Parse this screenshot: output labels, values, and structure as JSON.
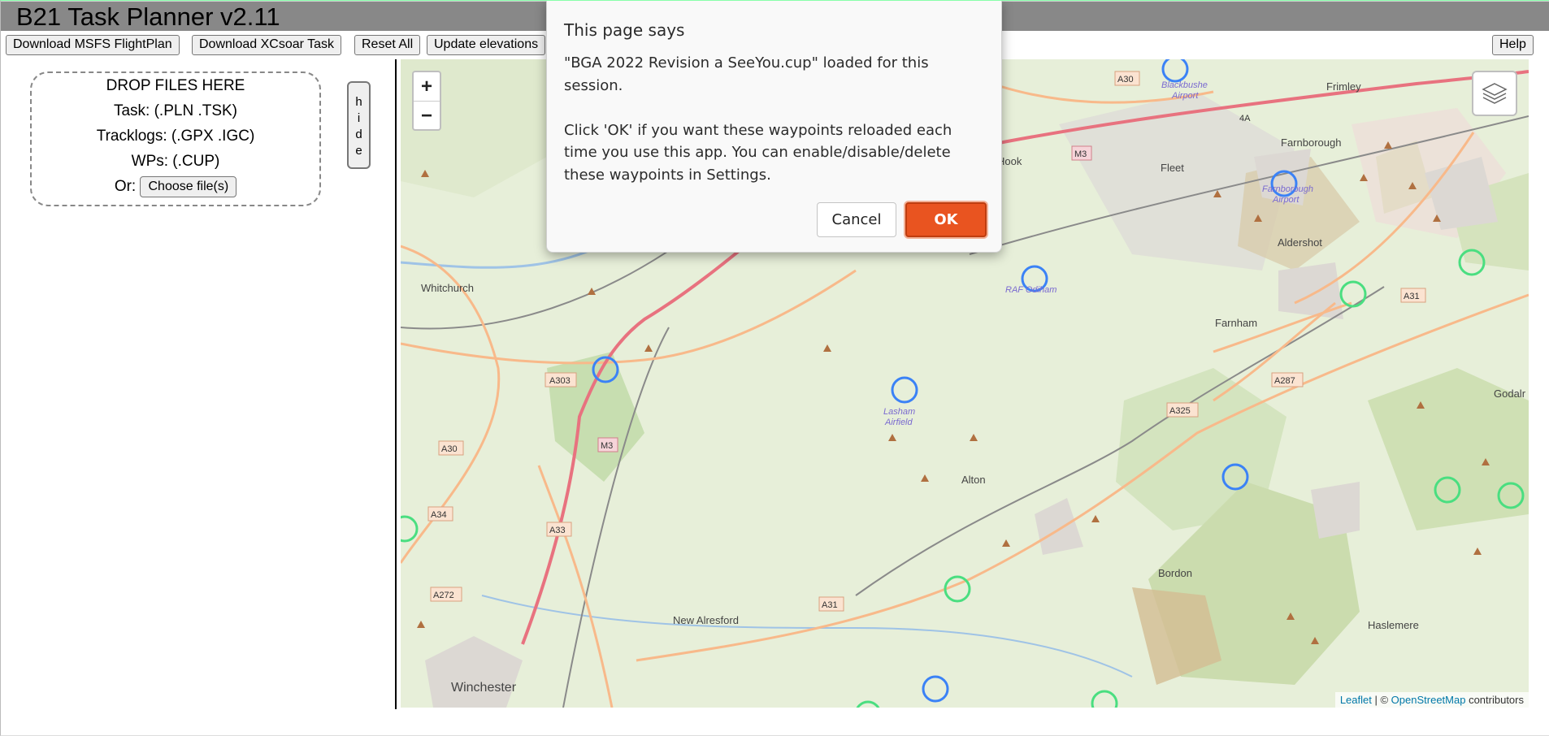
{
  "app": {
    "title": "B21 Task Planner v2.11"
  },
  "toolbar": {
    "download_flightplan": "Download MSFS FlightPlan",
    "download_xcsoar": "Download XCsoar Task",
    "reset_all": "Reset All",
    "update_elevations": "Update elevations",
    "help": "Help"
  },
  "dropzone": {
    "heading": "DROP FILES HERE",
    "task_line": "Task: (.PLN .TSK)",
    "tracklogs_line": "Tracklogs: (.GPX .IGC)",
    "wps_line": "WPs: (.CUP)",
    "or_label": "Or:",
    "choose_files": "Choose file(s)"
  },
  "hide_button": {
    "letters": [
      "h",
      "i",
      "d",
      "e"
    ]
  },
  "map": {
    "zoom_in": "+",
    "zoom_out": "−",
    "layers_icon": "layers-icon",
    "attribution": {
      "leaflet": "Leaflet",
      "separator": " | © ",
      "osm": "OpenStreetMap",
      "contributors": " contributors"
    },
    "places": {
      "whitchurch": "Whitchurch",
      "winchester": "Winchester",
      "new_alresford": "New Alresford",
      "alton": "Alton",
      "bordon": "Bordon",
      "haslemere": "Haslemere",
      "farnham": "Farnham",
      "aldershot": "Aldershot",
      "farnborough": "Farnborough",
      "fleet": "Fleet",
      "frimley": "Frimley",
      "hook": "Hook",
      "godalming": "Godalr",
      "lasham": "Lasham",
      "airfield": "Airfield",
      "blackbushe": "Blackbushe",
      "blackbushe_airport": "Airport",
      "farnborough_airport_1": "Farnborough",
      "farnborough_airport_2": "Airport",
      "raf_odiham": "RAF Odiham"
    },
    "roads": {
      "a303": "A303",
      "m3_a": "M3",
      "m3_b": "M3",
      "a30_a": "A30",
      "a30_b": "A30",
      "a34": "A34",
      "a33": "A33",
      "a272": "A272",
      "a31_a": "A31",
      "a31_b": "A31",
      "a325": "A325",
      "a287": "A287",
      "4a": "4A"
    },
    "colors": {
      "blue_marker": "#3b82f6",
      "green_marker": "#4ade80",
      "motorway": "#e8727f",
      "primary": "#f8b98a"
    }
  },
  "dialog": {
    "heading": "This page says",
    "message": "\"BGA 2022 Revision a SeeYou.cup\" loaded for this session.\n\nClick 'OK' if you want these waypoints reloaded each time you use this app. You can enable/disable/delete these waypoints in Settings.",
    "cancel": "Cancel",
    "ok": "OK"
  }
}
